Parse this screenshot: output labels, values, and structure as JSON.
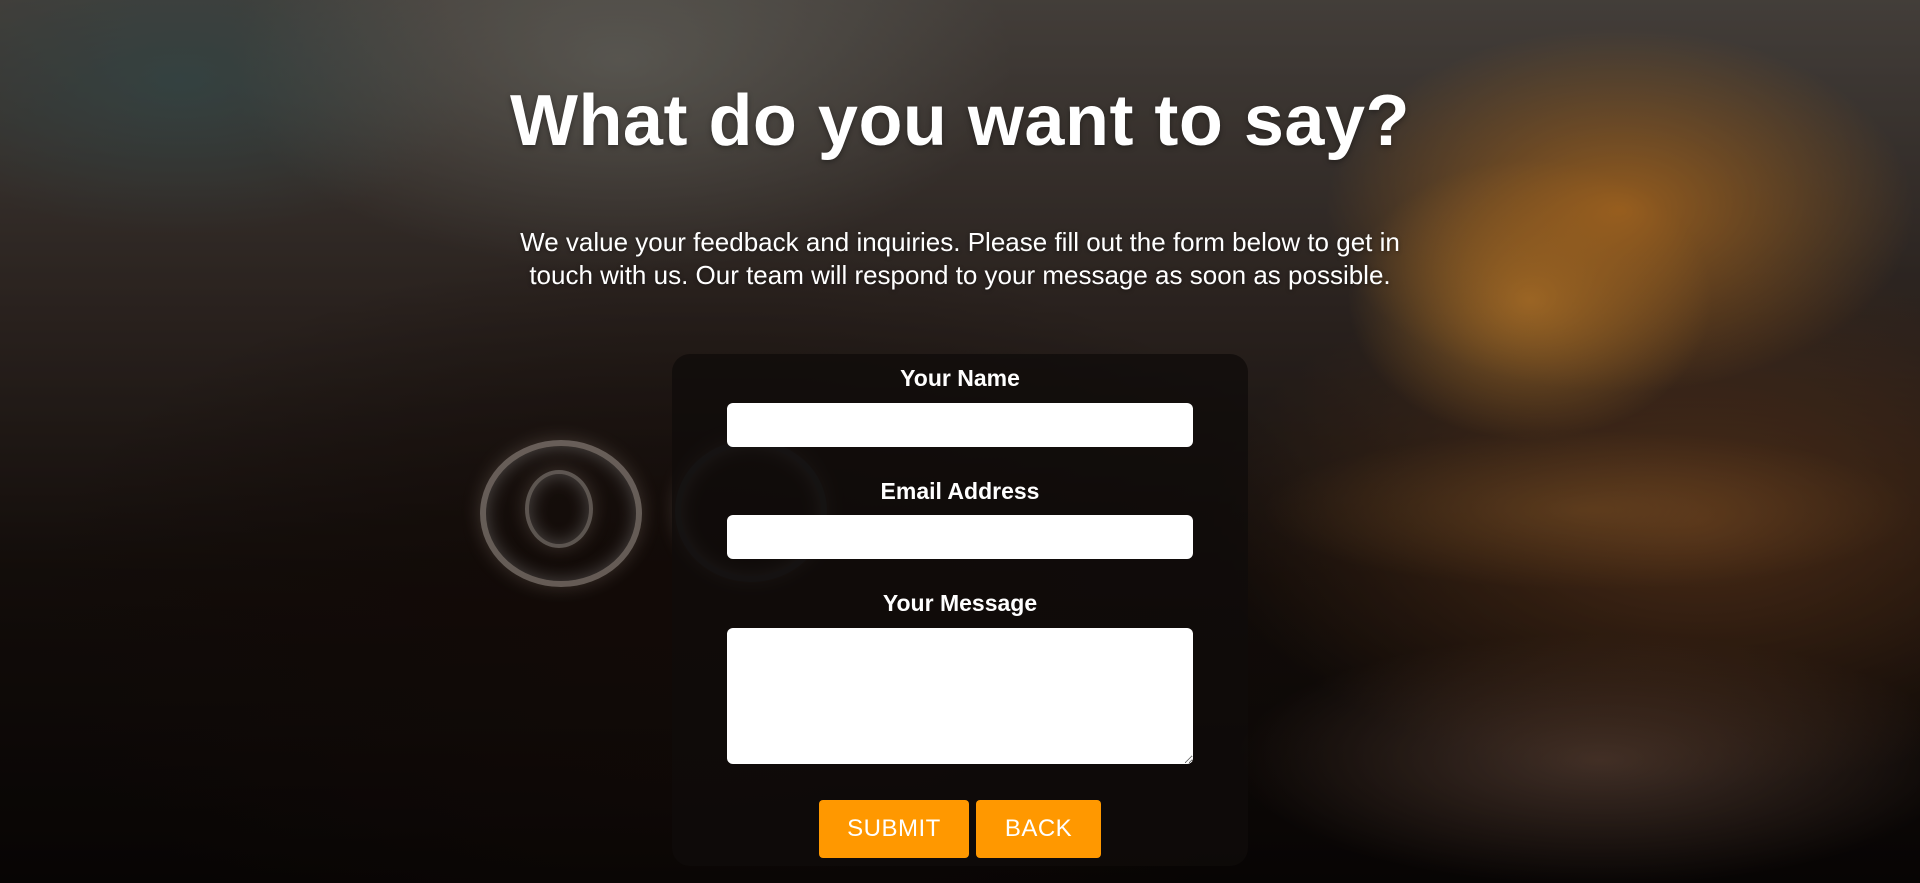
{
  "page": {
    "title": "What do you want to say?",
    "intro": "We value your feedback and inquiries. Please fill out the form below to get in touch with us. Our team will respond to your message as soon as possible."
  },
  "form": {
    "name_label": "Your Name",
    "name_value": "",
    "email_label": "Email Address",
    "email_value": "",
    "message_label": "Your Message",
    "message_value": "",
    "submit_label": "SUBMIT",
    "back_label": "BACK"
  },
  "colors": {
    "accent": "#ff9800",
    "text": "#ffffff",
    "card": "#0f0c0a"
  }
}
